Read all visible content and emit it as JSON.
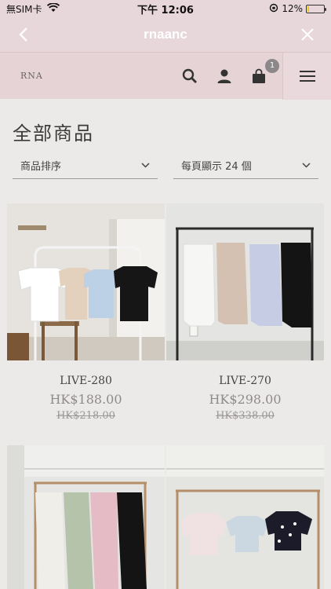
{
  "status_bar": {
    "carrier": "無SIM卡",
    "time": "下午 12:06",
    "battery": "12%",
    "battery_level": 0.12
  },
  "nav": {
    "title": "rnaanc"
  },
  "store_header": {
    "logo": "RNA",
    "cart_count": "1"
  },
  "page": {
    "title": "全部商品",
    "sort_label": "商品排序",
    "per_page_label": "每頁顯示 24 個"
  },
  "products": [
    {
      "name": "LIVE-280",
      "price": "HK$188.00",
      "old_price": "HK$218.00"
    },
    {
      "name": "LIVE-270",
      "price": "HK$298.00",
      "old_price": "HK$338.00"
    }
  ],
  "colors": {
    "header_bg": "#e7d6da",
    "page_bg": "#ebeae8",
    "price_gray": "#8f8a8b"
  }
}
